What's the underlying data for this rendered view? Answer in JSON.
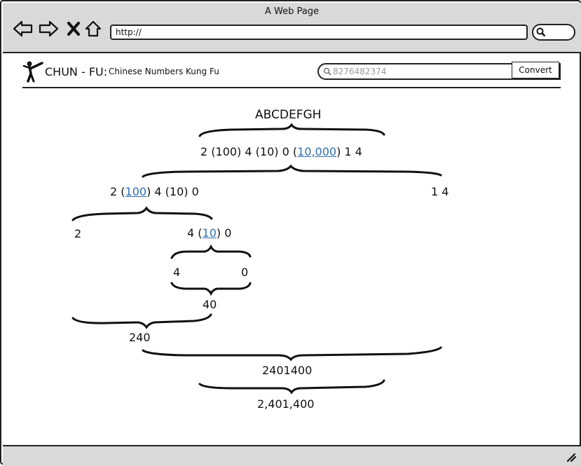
{
  "window": {
    "title": "A Web Page"
  },
  "browser": {
    "url": "http://",
    "nav_icons": [
      "back-arrow-icon",
      "forward-arrow-icon",
      "close-x-icon",
      "home-icon"
    ]
  },
  "header": {
    "brand": "CHUN - FU:",
    "subtitle": "Chinese Numbers Kung Fu",
    "search_placeholder": "8276482374",
    "convert_label": "Convert"
  },
  "tree": {
    "input": "ABCDEFGH",
    "level1": {
      "a": "2 (100) 4 (10) 0 (",
      "link": "10,000",
      "b": ") 1 4"
    },
    "level2_left": {
      "a": "2 (",
      "link": "100",
      "b": ") 4 (10) 0"
    },
    "level2_right": "1 4",
    "level3_left": "2",
    "level3_right": {
      "a": "4 (",
      "link": "10",
      "b": ") 0"
    },
    "level4_left": "4",
    "level4_right": "0",
    "sum_40": "40",
    "sum_240": "240",
    "sum_2401400": "2401400",
    "result": "2,401,400"
  },
  "colors": {
    "chrome": "#d9d9d9",
    "link": "#2f6fb3"
  }
}
